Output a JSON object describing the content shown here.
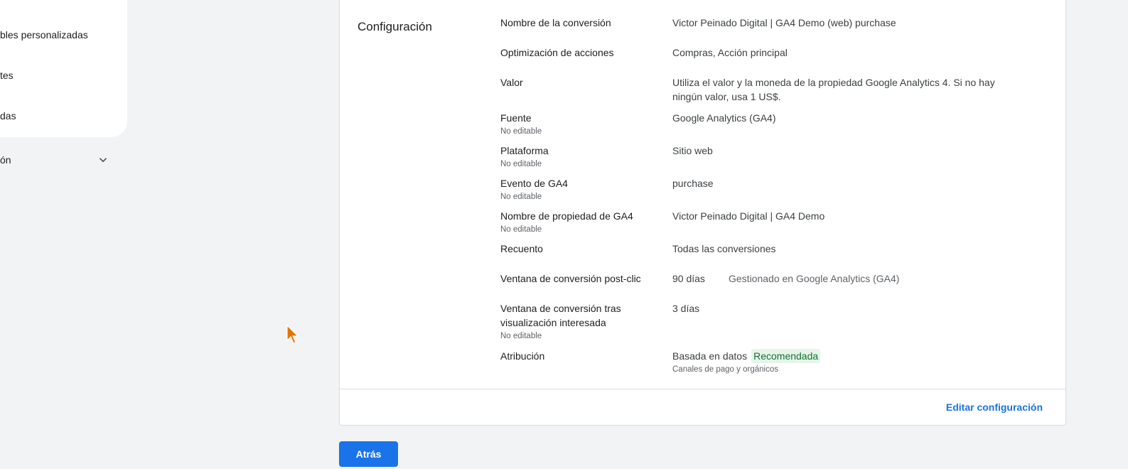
{
  "sidebar": {
    "items": [
      {
        "label": "bles personalizadas"
      },
      {
        "label": "tes"
      },
      {
        "label": "das"
      }
    ],
    "section": {
      "label": "ón",
      "icon": "chevron-down-icon"
    }
  },
  "config": {
    "title": "Configuración",
    "rows": [
      {
        "label": "Nombre de la conversión",
        "value": "Victor Peinado Digital | GA4 Demo (web) purchase"
      },
      {
        "label": "Optimización de acciones",
        "value": "Compras, Acción principal"
      },
      {
        "label": "Valor",
        "value": "Utiliza el valor y la moneda de la propiedad Google Analytics 4. Si no hay ningún valor, usa 1 US$."
      },
      {
        "label": "Fuente",
        "sublabel": "No editable",
        "value": "Google Analytics (GA4)"
      },
      {
        "label": "Plataforma",
        "sublabel": "No editable",
        "value": "Sitio web"
      },
      {
        "label": "Evento de GA4",
        "sublabel": "No editable",
        "value": "purchase"
      },
      {
        "label": "Nombre de propiedad de GA4",
        "sublabel": "No editable",
        "value": "Victor Peinado Digital | GA4 Demo"
      },
      {
        "label": "Recuento",
        "value": "Todas las conversiones"
      },
      {
        "label": "Ventana de conversión post-clic",
        "value": "90 días",
        "note": "Gestionado en Google Analytics (GA4)"
      },
      {
        "label": "Ventana de conversión tras visualización interesada",
        "sublabel": "No editable",
        "value": "3 días"
      },
      {
        "label": "Atribución",
        "value": "Basada en datos",
        "badge": "Recomendada",
        "value_sub": "Canales de pago y orgánicos"
      }
    ],
    "edit_link": "Editar configuración"
  },
  "back_button": "Atrás",
  "colors": {
    "accent": "#1a73e8",
    "badge_bg": "#e6f4ea",
    "badge_text": "#137333",
    "background": "#f1f3f4"
  }
}
